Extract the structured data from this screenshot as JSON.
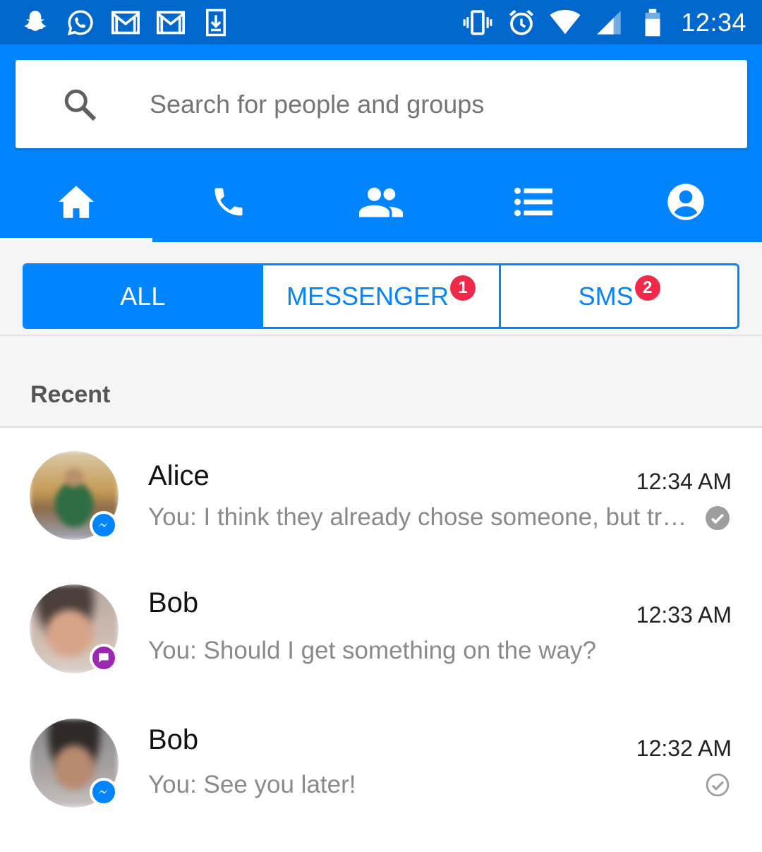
{
  "status_bar": {
    "time": "12:34",
    "left_icons": [
      "snapchat-icon",
      "whatsapp-icon",
      "gmail-icon",
      "gmail-icon",
      "download-icon"
    ],
    "right_icons": [
      "vibrate-icon",
      "alarm-icon",
      "wifi-icon",
      "signal-icon",
      "battery-icon"
    ]
  },
  "search": {
    "placeholder": "Search for people and groups"
  },
  "nav_tabs": [
    {
      "icon": "home-icon",
      "active": true
    },
    {
      "icon": "phone-icon",
      "active": false
    },
    {
      "icon": "people-icon",
      "active": false
    },
    {
      "icon": "list-icon",
      "active": false
    },
    {
      "icon": "profile-icon",
      "active": false
    }
  ],
  "filters": [
    {
      "label": "ALL",
      "active": true,
      "badge": ""
    },
    {
      "label": "MESSENGER",
      "active": false,
      "badge": "1"
    },
    {
      "label": "SMS",
      "active": false,
      "badge": "2"
    }
  ],
  "section": {
    "title": "Recent"
  },
  "conversations": [
    {
      "name": "Alice",
      "time": "12:34 AM",
      "snippet": "You: I think they already chose someone, but tr…",
      "source_icon": "messenger-icon",
      "status": "seen-filled"
    },
    {
      "name": "Bob",
      "time": "12:33 AM",
      "snippet": "You: Should I get something on the way?",
      "source_icon": "sms-icon",
      "status": "none"
    },
    {
      "name": "Bob",
      "time": "12:32 AM",
      "snippet": "You: See you later!",
      "source_icon": "messenger-icon",
      "status": "sent-outline"
    }
  ],
  "colors": {
    "status_bar": "#0068cc",
    "brand": "#0084ff",
    "badge": "#f02849",
    "sms_badge": "#9c27b0"
  }
}
